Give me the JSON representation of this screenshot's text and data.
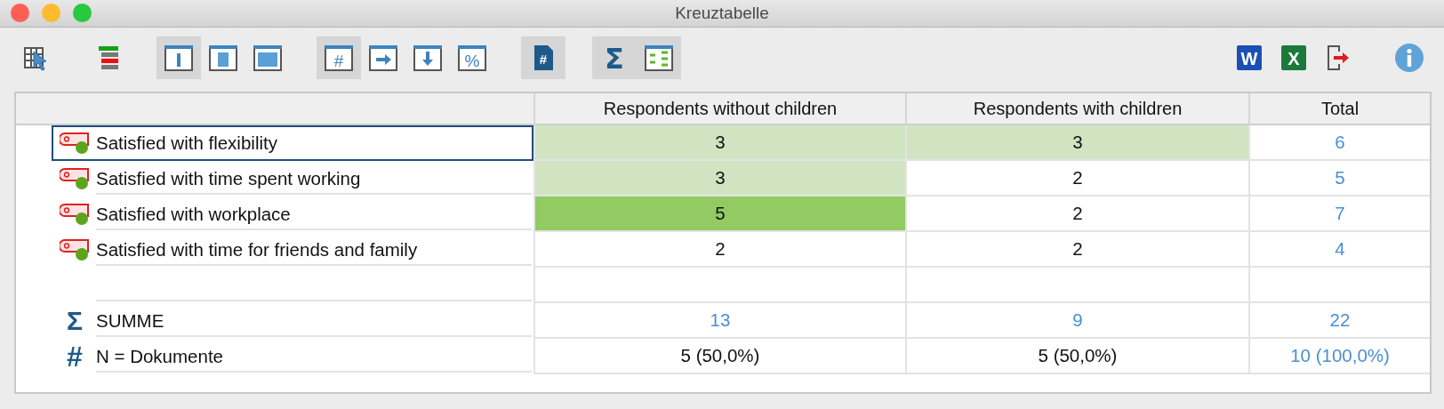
{
  "window": {
    "title": "Kreuztabelle"
  },
  "toolbar": [
    {
      "selected": false
    },
    {
      "selected": false
    },
    {
      "selected": true
    },
    {
      "selected": false
    },
    {
      "selected": false
    },
    {
      "selected": true,
      "label": "#"
    },
    {
      "selected": false
    },
    {
      "selected": false
    },
    {
      "selected": false,
      "label": "%"
    },
    {
      "selected": true,
      "label": "#"
    },
    {
      "selected": true,
      "label": "Σ"
    },
    {
      "selected": true
    },
    {
      "selected": false,
      "label": "W"
    },
    {
      "selected": false,
      "label": "X"
    },
    {
      "selected": false
    },
    {
      "selected": false
    }
  ],
  "table": {
    "columns": [
      {
        "label": "Respondents without children",
        "kind": "group"
      },
      {
        "label": "Respondents with children",
        "kind": "group"
      },
      {
        "label": "Total",
        "kind": "total"
      }
    ],
    "rows": [
      {
        "kind": "code",
        "label": "Satisfied with flexibility",
        "selected": true,
        "cells": [
          {
            "value": "3",
            "color": "#d0e4c2"
          },
          {
            "value": "3",
            "color": "#d0e4c2"
          },
          {
            "value": "6"
          }
        ]
      },
      {
        "kind": "code",
        "label": "Satisfied with time spent working",
        "selected": false,
        "cells": [
          {
            "value": "3",
            "color": "#d0e4c2"
          },
          {
            "value": "2"
          },
          {
            "value": "5"
          }
        ]
      },
      {
        "kind": "code",
        "label": "Satisfied with workplace",
        "selected": false,
        "cells": [
          {
            "value": "5",
            "color": "#92cb62"
          },
          {
            "value": "2"
          },
          {
            "value": "7"
          }
        ]
      },
      {
        "kind": "code",
        "label": "Satisfied with time for friends and family",
        "selected": false,
        "cells": [
          {
            "value": "2"
          },
          {
            "value": "2"
          },
          {
            "value": "4"
          }
        ]
      },
      {
        "kind": "spacer"
      },
      {
        "kind": "sum",
        "symbol": "Σ",
        "label": "SUMME",
        "cells": [
          {
            "value": "13"
          },
          {
            "value": "9"
          },
          {
            "value": "22"
          }
        ]
      },
      {
        "kind": "n",
        "symbol": "#",
        "label": "N = Dokumente",
        "cells": [
          {
            "value": "5 (50,0%)"
          },
          {
            "value": "5 (50,0%)"
          },
          {
            "value": "10 (100,0%)"
          }
        ]
      }
    ]
  }
}
